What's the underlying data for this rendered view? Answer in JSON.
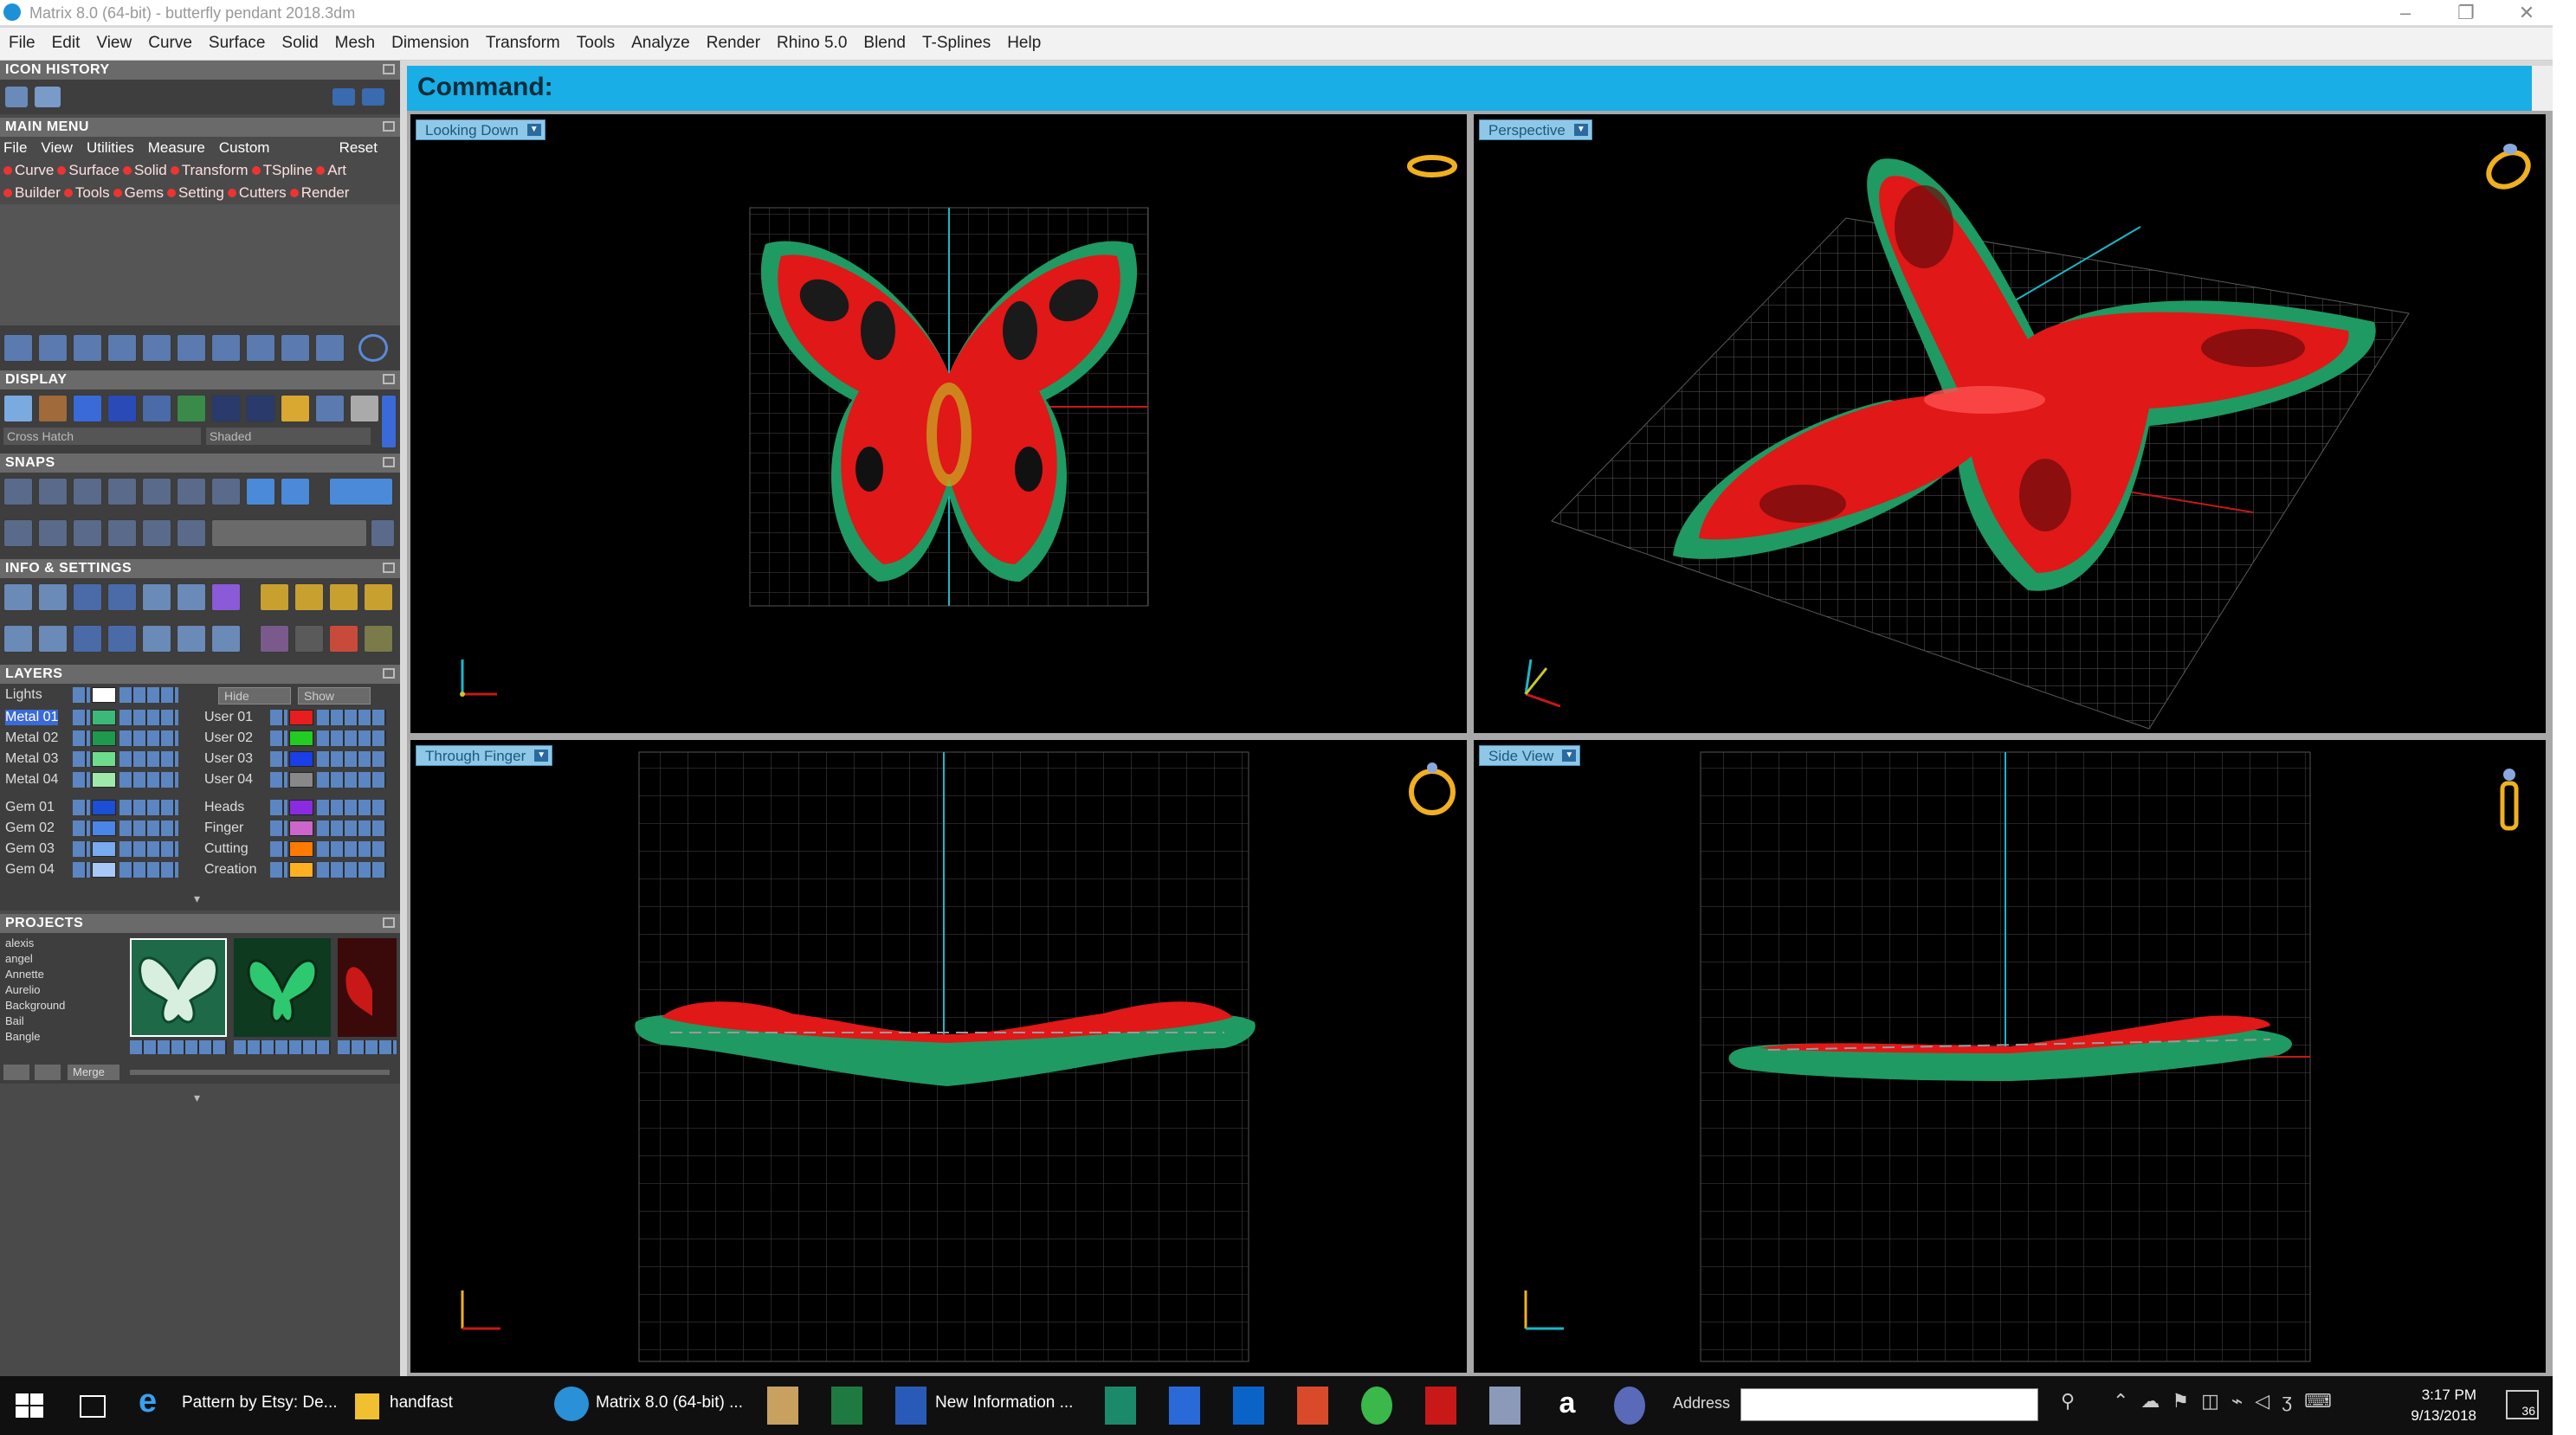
{
  "window": {
    "title": "Matrix 8.0 (64-bit) - butterfly pendant 2018.3dm",
    "controls": [
      "–",
      "❐",
      "✕"
    ]
  },
  "menubar": [
    "File",
    "Edit",
    "View",
    "Curve",
    "Surface",
    "Solid",
    "Mesh",
    "Dimension",
    "Transform",
    "Tools",
    "Analyze",
    "Render",
    "Rhino 5.0",
    "Blend",
    "T-Splines",
    "Help"
  ],
  "panels": {
    "icon_history": "ICON HISTORY",
    "main_menu": "MAIN MENU",
    "main_menu_nav": [
      "File",
      "View",
      "Utilities",
      "Measure",
      "Custom"
    ],
    "main_menu_reset": "Reset",
    "main_menu_row1": [
      "Curve",
      "Surface",
      "Solid",
      "Transform",
      "TSpline",
      "Art"
    ],
    "main_menu_row2": [
      "Builder",
      "Tools",
      "Gems",
      "Setting",
      "Cutters",
      "Render"
    ],
    "display": "DISPLAY",
    "display_modes": [
      "Cross Hatch",
      "Shaded"
    ],
    "snaps": "SNAPS",
    "info_settings": "INFO & SETTINGS",
    "layers": "LAYERS",
    "layers_lights": "Lights",
    "layers_hide": "Hide",
    "layers_show": "Show",
    "layers_left": [
      {
        "name": "Metal 01",
        "color": "#3cb878"
      },
      {
        "name": "Metal 02",
        "color": "#1e9a4e"
      },
      {
        "name": "Metal 03",
        "color": "#6edc8c"
      },
      {
        "name": "Metal 04",
        "color": "#9ee8ac"
      },
      {
        "name": "Gem 01",
        "color": "#1a4fd6"
      },
      {
        "name": "Gem 02",
        "color": "#4a86e8"
      },
      {
        "name": "Gem 03",
        "color": "#7aaaf0"
      },
      {
        "name": "Gem 04",
        "color": "#a8c8f8"
      }
    ],
    "layers_right": [
      {
        "name": "User 01",
        "color": "#e81e1e"
      },
      {
        "name": "User 02",
        "color": "#22cc22"
      },
      {
        "name": "User 03",
        "color": "#1a3ee8"
      },
      {
        "name": "User 04",
        "color": "#888888"
      },
      {
        "name": "Heads",
        "color": "#8a2be2"
      },
      {
        "name": "Finger",
        "color": "#cc66cc"
      },
      {
        "name": "Cutting",
        "color": "#ff7a00"
      },
      {
        "name": "Creation",
        "color": "#ffb020"
      }
    ],
    "projects": "PROJECTS",
    "project_list": [
      "alexis",
      "angel",
      "Annette",
      "Aurelio",
      "Background",
      "Bail",
      "Bangle"
    ],
    "projects_button": "Merge"
  },
  "command": {
    "label": "Command:"
  },
  "viewports": [
    {
      "label": "Looking Down"
    },
    {
      "label": "Perspective"
    },
    {
      "label": "Through Finger"
    },
    {
      "label": "Side View"
    }
  ],
  "taskbar": {
    "items": [
      {
        "label": "Pattern by Etsy: De..."
      },
      {
        "label": "handfast"
      },
      {
        "label": "Matrix 8.0 (64-bit) ..."
      },
      {
        "label": "New Information ..."
      }
    ],
    "address_label": "Address",
    "time": "3:17 PM",
    "date": "9/13/2018",
    "notif_count": "36"
  },
  "colors": {
    "metal": "#1f9a62",
    "gem_red": "#e01818",
    "grid": "#3a3a3a",
    "accent_blue": "#19aee6",
    "axis_cyan": "#1ab8c8"
  }
}
